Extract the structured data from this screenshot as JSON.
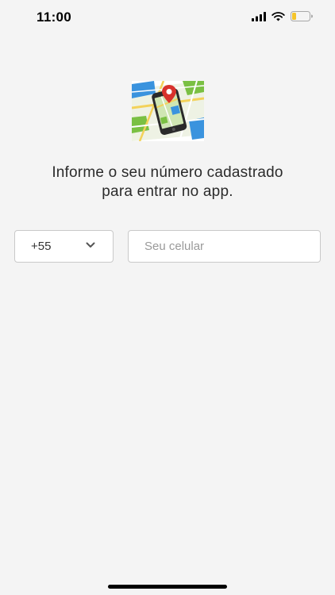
{
  "status_bar": {
    "time": "11:00",
    "icons": [
      "cellular-signal-icon",
      "wifi-icon",
      "battery-low-icon"
    ]
  },
  "hero": {
    "image": "phone-on-city-map-with-location-pin"
  },
  "login": {
    "headline_line1": "Informe o seu número cadastrado",
    "headline_line2": "para entrar no app.",
    "country_code": "+55",
    "phone_placeholder": "Seu celular",
    "phone_value": ""
  },
  "colors": {
    "background": "#f4f4f4",
    "field_border": "#c9c9c9",
    "battery_fill": "#f5c52b",
    "pin": "#d8322c"
  }
}
